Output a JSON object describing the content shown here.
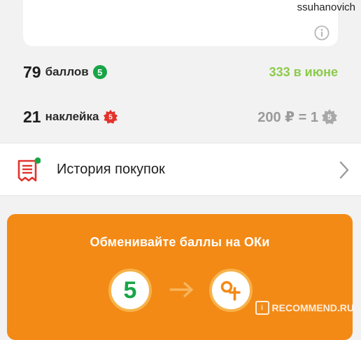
{
  "watermark_user": "ssuhanovich",
  "points": {
    "count": "79",
    "label": "баллов",
    "badge": "5",
    "month_amount": "333 в июне"
  },
  "stickers": {
    "count": "21",
    "label": "наклейка",
    "rate": "200 ₽ = 1"
  },
  "history": {
    "label": "История покупок"
  },
  "exchange": {
    "title": "Обменивайте баллы на ОКи",
    "left_coin": "5"
  },
  "recommend": {
    "logo": "i",
    "text": "RECOMMEND.RU"
  },
  "colors": {
    "orange": "#f38a16",
    "green": "#19a547",
    "light_green": "#8ccb4b",
    "red": "#e2332d"
  }
}
